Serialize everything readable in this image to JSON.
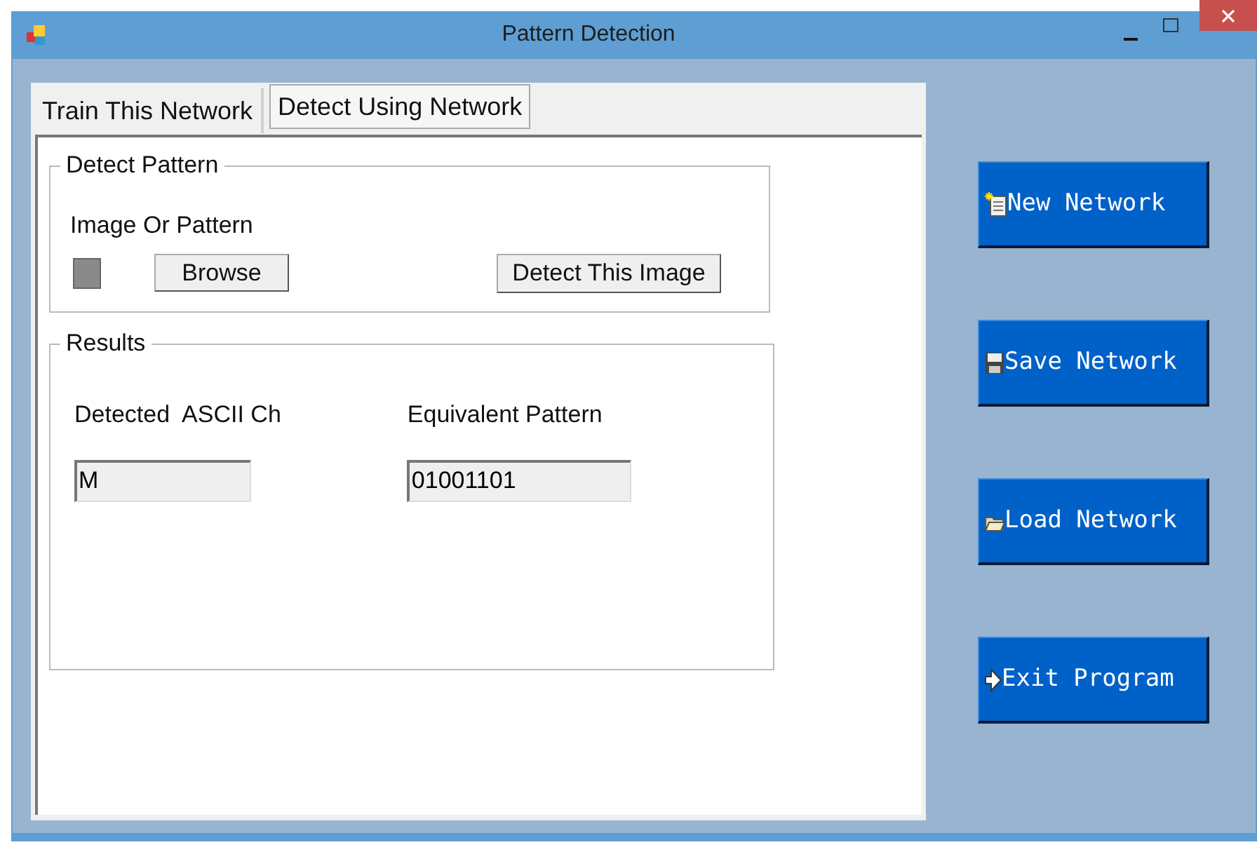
{
  "window": {
    "title": "Pattern Detection"
  },
  "tabs": [
    {
      "label": "Train This Network",
      "selected": false
    },
    {
      "label": "Detect Using Network",
      "selected": true
    }
  ],
  "detect_pattern": {
    "title": "Detect Pattern",
    "image_label": "Image Or Pattern",
    "browse_button": "Browse",
    "detect_button": "Detect This Image"
  },
  "results": {
    "title": "Results",
    "fields": [
      {
        "label": "Detected  ASCII Ch",
        "value": "M"
      },
      {
        "label": "Equivalent Pattern",
        "value": "01001101"
      }
    ]
  },
  "actions": [
    {
      "kind": "new",
      "label": "New Network"
    },
    {
      "kind": "save",
      "label": "Save Network"
    },
    {
      "kind": "load",
      "label": "Load Network"
    },
    {
      "kind": "exit",
      "label": "Exit Program"
    }
  ]
}
